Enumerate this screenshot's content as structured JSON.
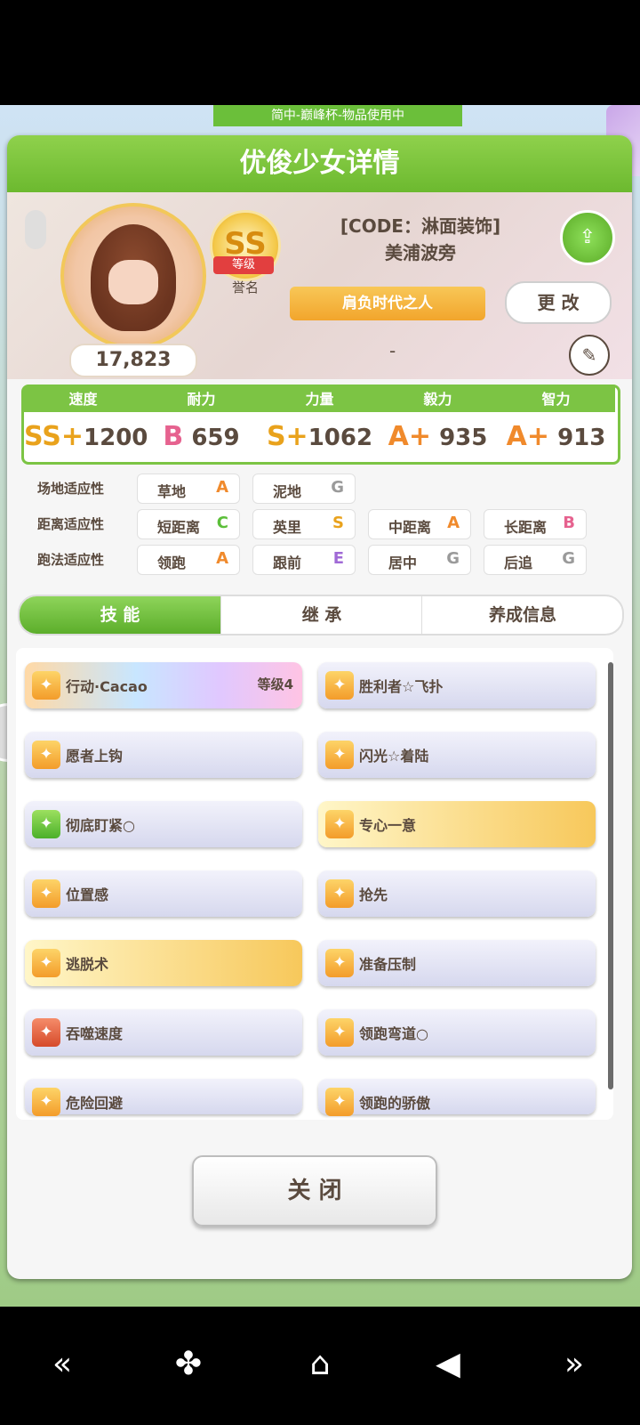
{
  "banner": "简中-巅峰杯-物品使用中",
  "panel_title": "优俊少女详情",
  "fans": "17,823",
  "rank": {
    "grade": "SS",
    "ribbon": "等级",
    "text": "誉名"
  },
  "code_title": "[CODE：淋面装饰]",
  "name": "美浦波旁",
  "title_ribbon": "肩负时代之人",
  "change_button": "更 改",
  "dash": "-",
  "stats": [
    {
      "label": "速度",
      "grade": "SS+",
      "value": "1200",
      "grade_color": "#e9a21c"
    },
    {
      "label": "耐力",
      "grade": "B",
      "value": "659",
      "grade_color": "#e6628f"
    },
    {
      "label": "力量",
      "grade": "S+",
      "value": "1062",
      "grade_color": "#e9a21c"
    },
    {
      "label": "毅力",
      "grade": "A+",
      "value": "935",
      "grade_color": "#f08a2c"
    },
    {
      "label": "智力",
      "grade": "A+",
      "value": "913",
      "grade_color": "#f08a2c"
    }
  ],
  "aptitudes": [
    {
      "label": "场地适应性",
      "items": [
        {
          "name": "草地",
          "grade": "A",
          "color": "#f08a2c"
        },
        {
          "name": "泥地",
          "grade": "G",
          "color": "#9a9a9a"
        }
      ]
    },
    {
      "label": "距离适应性",
      "items": [
        {
          "name": "短距离",
          "grade": "C",
          "color": "#5cbf3a"
        },
        {
          "name": "英里",
          "grade": "S",
          "color": "#e9a21c"
        },
        {
          "name": "中距离",
          "grade": "A",
          "color": "#f08a2c"
        },
        {
          "name": "长距离",
          "grade": "B",
          "color": "#e6628f"
        }
      ]
    },
    {
      "label": "跑法适应性",
      "items": [
        {
          "name": "领跑",
          "grade": "A",
          "color": "#f08a2c"
        },
        {
          "name": "跟前",
          "grade": "E",
          "color": "#a06ad6"
        },
        {
          "name": "居中",
          "grade": "G",
          "color": "#9a9a9a"
        },
        {
          "name": "后追",
          "grade": "G",
          "color": "#9a9a9a"
        }
      ]
    }
  ],
  "tabs": [
    "技 能",
    "继 承",
    "养成信息"
  ],
  "skills": [
    {
      "label": "行动·Cacao",
      "level": "等级4",
      "style": "rainbow",
      "icon": "gold"
    },
    {
      "label": "胜利者☆飞扑",
      "style": "plain",
      "icon": "gold"
    },
    {
      "label": "愿者上钩",
      "style": "plain",
      "icon": "gold"
    },
    {
      "label": "闪光☆着陆",
      "style": "plain",
      "icon": "gold"
    },
    {
      "label": "彻底盯紧○",
      "style": "plain",
      "icon": "green"
    },
    {
      "label": "专心一意",
      "style": "gold",
      "icon": "gold"
    },
    {
      "label": "位置感",
      "style": "plain",
      "icon": "gold"
    },
    {
      "label": "抢先",
      "style": "plain",
      "icon": "gold"
    },
    {
      "label": "逃脱术",
      "style": "gold",
      "icon": "gold"
    },
    {
      "label": "准备压制",
      "style": "plain",
      "icon": "gold"
    },
    {
      "label": "吞噬速度",
      "style": "plain",
      "icon": "red"
    },
    {
      "label": "领跑弯道○",
      "style": "plain",
      "icon": "gold"
    },
    {
      "label": "危险回避",
      "style": "plain",
      "icon": "gold"
    },
    {
      "label": "领跑的骄傲",
      "style": "plain",
      "icon": "gold"
    }
  ],
  "close_button": "关 闭",
  "nav": [
    "«",
    "✤",
    "⌂",
    "◀",
    "»"
  ]
}
